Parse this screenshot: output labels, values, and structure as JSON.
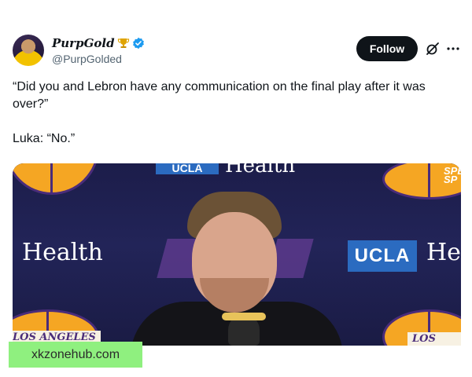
{
  "header": {
    "display_name": "PurpGold",
    "handle": "@PurpGolded",
    "follow_label": "Follow",
    "icons": {
      "badge": "trophy-icon",
      "verified": "verified-icon",
      "grok": "grok-icon",
      "more": "more-icon"
    },
    "colors": {
      "follow_bg": "#0f1419",
      "verified": "#1d9bf0",
      "handle": "#536471"
    }
  },
  "post": {
    "quote": "“Did you and Lebron have any communication on the final play after it was over?”",
    "reply": "Luka: “No.”"
  },
  "media": {
    "signs": {
      "health": "Health",
      "ucla": "UCLA",
      "health_partial": "He",
      "los_angeles": "LOS ANGELES",
      "los_angeles_partial": "LOS AN",
      "top_ucla": "UCLA",
      "top_health": "Health",
      "spectrum": "SPE SP"
    }
  },
  "watermark": "xkzonehub.com"
}
